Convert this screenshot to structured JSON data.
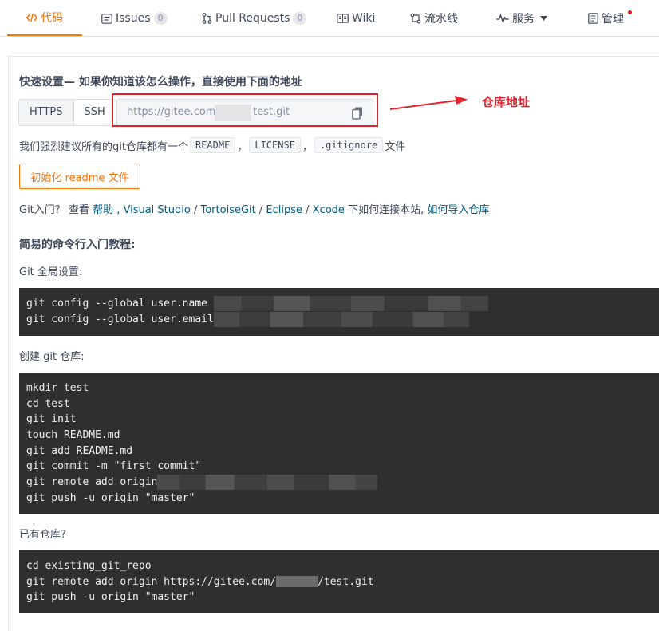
{
  "tabs": [
    {
      "label": "代码",
      "icon": "code-icon",
      "active": true
    },
    {
      "label": "Issues",
      "icon": "issues-icon",
      "count": "0"
    },
    {
      "label": "Pull Requests",
      "icon": "pull-request-icon",
      "count": "0"
    },
    {
      "label": "Wiki",
      "icon": "wiki-icon"
    },
    {
      "label": "流水线",
      "icon": "pipeline-icon"
    },
    {
      "label": "服务",
      "icon": "pulse-icon",
      "dropdown": true
    },
    {
      "label": "管理",
      "icon": "manage-icon",
      "notification": true
    }
  ],
  "quick_setup": {
    "heading": "快速设置— 如果你知道该怎么操作，直接使用下面的地址",
    "https_label": "HTTPS",
    "ssh_label": "SSH",
    "url_prefix": "https://gitee.com/",
    "url_suffix": "test.git",
    "annotation": "仓库地址"
  },
  "recommend": {
    "text_before": "我们强烈建议所有的git仓库都有一个",
    "chips": [
      "README",
      "LICENSE",
      ".gitignore"
    ],
    "sep": "，",
    "text_after": "文件"
  },
  "init_button": "初始化 readme 文件",
  "git_intro": {
    "prefix": "Git入门？ 查看 ",
    "help": "帮助",
    "sep1": " , ",
    "vs": "Visual Studio",
    "slash": " / ",
    "tortoise": "TortoiseGit",
    "eclipse": "Eclipse",
    "xcode": "Xcode",
    "middle": " 下如何连接本站, ",
    "import": "如何导入仓库"
  },
  "tutorial": {
    "heading": "简易的命令行入门教程:",
    "global_label": "Git 全局设置:",
    "global_lines": [
      "git config --global user.name ",
      "git config --global user.email"
    ],
    "create_label": "创建 git 仓库:",
    "create_lines": [
      "mkdir test",
      "cd test",
      "git init",
      "touch README.md",
      "git add README.md",
      "git commit -m \"first commit\"",
      "git remote add origin",
      "git push -u origin \"master\""
    ],
    "existing_label": "已有仓库?",
    "existing_lines": [
      "cd existing_git_repo",
      "git remote add origin https://gitee.com/",
      "/test.git",
      "git push -u origin \"master\""
    ]
  },
  "colors": {
    "accent": "#fe7300",
    "annotation": "#e3232b",
    "link": "#005980",
    "code_bg": "#2f2f2f"
  }
}
